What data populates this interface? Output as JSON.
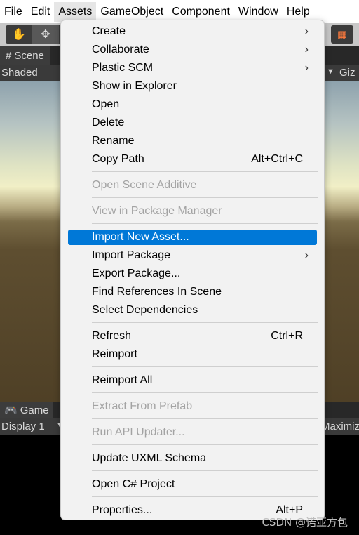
{
  "menubar": {
    "items": [
      {
        "label": "File"
      },
      {
        "label": "Edit"
      },
      {
        "label": "Assets"
      },
      {
        "label": "GameObject"
      },
      {
        "label": "Component"
      },
      {
        "label": "Window"
      },
      {
        "label": "Help"
      }
    ],
    "active": "Assets"
  },
  "toolbar": {
    "tools": [
      "hand-tool",
      "move-tool"
    ],
    "right_icon": "grid-snap-icon"
  },
  "scene": {
    "tab_label": "Scene",
    "shading_mode": "Shaded",
    "gizmos_label": "Giz"
  },
  "game": {
    "tab_label": "Game",
    "display": "Display 1",
    "maximize_label": "Maximiz"
  },
  "context_menu": {
    "items": [
      {
        "label": "Create",
        "submenu": true
      },
      {
        "label": "Collaborate",
        "submenu": true
      },
      {
        "label": "Plastic SCM",
        "submenu": true
      },
      {
        "label": "Show in Explorer"
      },
      {
        "label": "Open"
      },
      {
        "label": "Delete"
      },
      {
        "label": "Rename"
      },
      {
        "label": "Copy Path",
        "shortcut": "Alt+Ctrl+C"
      },
      {
        "label": "Open Scene Additive",
        "disabled": true
      },
      {
        "label": "View in Package Manager",
        "disabled": true
      },
      {
        "label": "Import New Asset...",
        "highlighted": true
      },
      {
        "label": "Import Package",
        "submenu": true
      },
      {
        "label": "Export Package..."
      },
      {
        "label": "Find References In Scene"
      },
      {
        "label": "Select Dependencies"
      },
      {
        "label": "Refresh",
        "shortcut": "Ctrl+R"
      },
      {
        "label": "Reimport"
      },
      {
        "label": "Reimport All"
      },
      {
        "label": "Extract From Prefab",
        "disabled": true
      },
      {
        "label": "Run API Updater...",
        "disabled": true
      },
      {
        "label": "Update UXML Schema"
      },
      {
        "label": "Open C# Project"
      },
      {
        "label": "Properties...",
        "shortcut": "Alt+P"
      }
    ]
  },
  "watermark": "CSDN @诺亚方包",
  "colors": {
    "highlight": "#0078d7",
    "disabled_text": "#a3a3a3",
    "menu_bg": "#f2f2f2"
  }
}
